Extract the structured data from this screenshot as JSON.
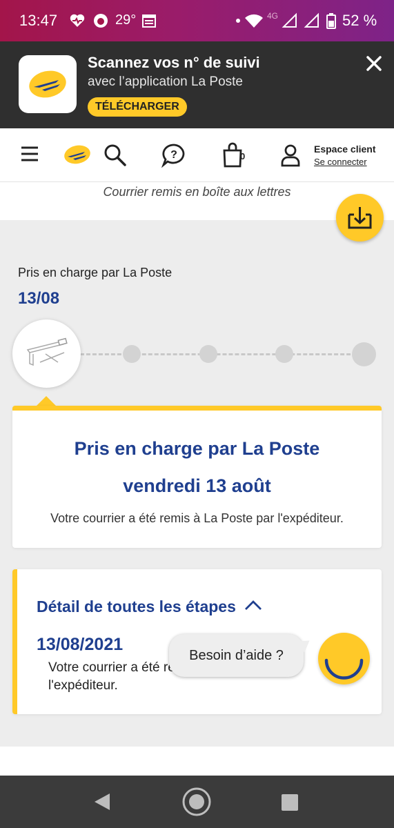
{
  "status_bar": {
    "time": "13:47",
    "temperature": "29°",
    "network": "4G",
    "battery": "52 %"
  },
  "banner": {
    "title": "Scannez vos n° de suivi",
    "subtitle": "avec l’application La Poste",
    "download_label": "TÉLÉCHARGER"
  },
  "header": {
    "cart_count": "0",
    "account_title": "Espace client",
    "account_link": "Se connecter"
  },
  "tracking": {
    "previous_status": "Courrier remis en boîte aux lettres",
    "current_step_label": "Pris en charge par La Poste",
    "current_step_date": "13/08",
    "timeline_total_steps": 5,
    "timeline_current_step": 1
  },
  "current_card": {
    "title": "Pris en charge par La Poste",
    "date": "vendredi 13 août",
    "description": "Votre courrier a été remis à La Poste par l'expéditeur."
  },
  "details": {
    "title": "Détail de toutes les étapes",
    "entries": [
      {
        "date": "13/08/2021",
        "text": "Votre courrier a été remis à La Poste par l'expéditeur."
      }
    ]
  },
  "help": {
    "label": "Besoin d’aide ?"
  },
  "colors": {
    "brand_yellow": "#ffc928",
    "brand_blue": "#1f3f8f",
    "banner_bg": "#2f2f2f"
  }
}
